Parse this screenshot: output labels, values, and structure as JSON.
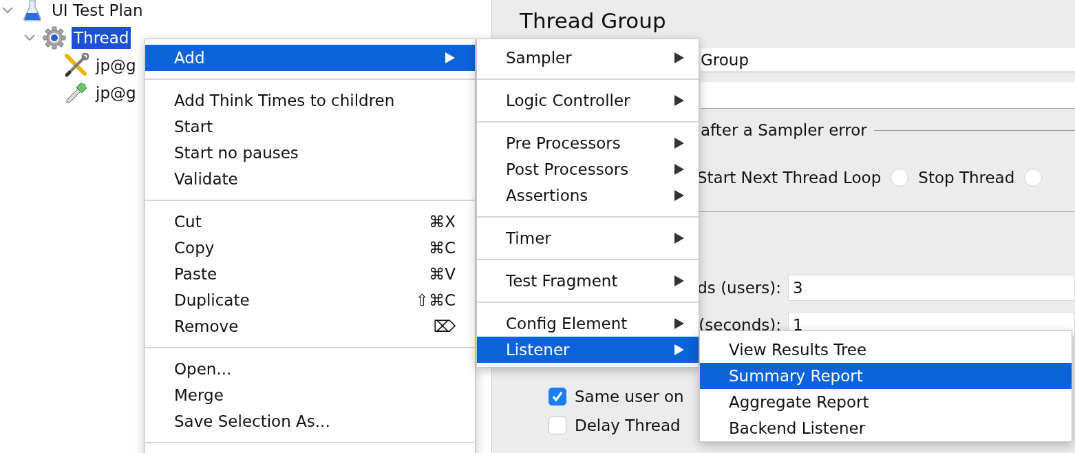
{
  "tree": [
    {
      "label": "UI Test Plan",
      "kind": "plan",
      "expanded": true,
      "selected": false,
      "children": [
        {
          "label": "Thread",
          "kind": "thread-group",
          "expanded": true,
          "selected": true,
          "children": [
            {
              "label": "jp@g",
              "kind": "config",
              "selected": false
            },
            {
              "label": "jp@g",
              "kind": "sampler",
              "selected": false
            }
          ]
        }
      ]
    }
  ],
  "panel": {
    "title": "Thread Group",
    "name_field": {
      "value": "Group"
    },
    "error_action": {
      "legend": "after a Sampler error",
      "options": [
        {
          "label": "Start Next Thread Loop"
        },
        {
          "label": "Stop Thread",
          "selected": false
        },
        {
          "selected": false
        }
      ]
    },
    "thread_properties": {
      "rows": [
        {
          "label": "ds (users):",
          "value": "3"
        },
        {
          "label": "(seconds):",
          "value": "1"
        }
      ],
      "checkboxes": [
        {
          "label": "Same user on",
          "checked": true
        },
        {
          "label": "Delay Thread",
          "checked": false
        }
      ]
    }
  },
  "context_menu": {
    "items": [
      {
        "kind": "submenu",
        "label": "Add",
        "selected": true
      },
      {
        "kind": "separator"
      },
      {
        "kind": "item",
        "label": "Add Think Times to children",
        "selected": false
      },
      {
        "kind": "item",
        "label": "Start",
        "selected": false
      },
      {
        "kind": "item",
        "label": "Start no pauses",
        "selected": false
      },
      {
        "kind": "item",
        "label": "Validate",
        "selected": false
      },
      {
        "kind": "separator"
      },
      {
        "kind": "item",
        "label": "Cut",
        "shortcut": "⌘X",
        "selected": false
      },
      {
        "kind": "item",
        "label": "Copy",
        "shortcut": "⌘C",
        "selected": false
      },
      {
        "kind": "item",
        "label": "Paste",
        "shortcut": "⌘V",
        "selected": false
      },
      {
        "kind": "item",
        "label": "Duplicate",
        "shortcut": "⇧⌘C",
        "selected": false
      },
      {
        "kind": "item",
        "label": "Remove",
        "shortcut": "⌦",
        "selected": false
      },
      {
        "kind": "separator"
      },
      {
        "kind": "item",
        "label": "Open...",
        "selected": false
      },
      {
        "kind": "item",
        "label": "Merge",
        "selected": false
      },
      {
        "kind": "item",
        "label": "Save Selection As...",
        "selected": false
      },
      {
        "kind": "separator"
      }
    ]
  },
  "add_submenu": {
    "items": [
      {
        "kind": "submenu",
        "label": "Sampler",
        "selected": false
      },
      {
        "kind": "separator"
      },
      {
        "kind": "submenu",
        "label": "Logic Controller",
        "selected": false
      },
      {
        "kind": "separator"
      },
      {
        "kind": "submenu",
        "label": "Pre Processors",
        "selected": false
      },
      {
        "kind": "submenu",
        "label": "Post Processors",
        "selected": false
      },
      {
        "kind": "submenu",
        "label": "Assertions",
        "selected": false
      },
      {
        "kind": "separator"
      },
      {
        "kind": "submenu",
        "label": "Timer",
        "selected": false
      },
      {
        "kind": "separator"
      },
      {
        "kind": "submenu",
        "label": "Test Fragment",
        "selected": false
      },
      {
        "kind": "separator"
      },
      {
        "kind": "submenu",
        "label": "Config Element",
        "selected": false
      },
      {
        "kind": "submenu",
        "label": "Listener",
        "selected": true
      }
    ]
  },
  "listener_submenu": {
    "items": [
      {
        "kind": "item",
        "label": "View Results Tree",
        "selected": false
      },
      {
        "kind": "item",
        "label": "Summary Report",
        "selected": true
      },
      {
        "kind": "item",
        "label": "Aggregate Report",
        "selected": false
      },
      {
        "kind": "item",
        "label": "Backend Listener",
        "selected": false
      }
    ]
  }
}
